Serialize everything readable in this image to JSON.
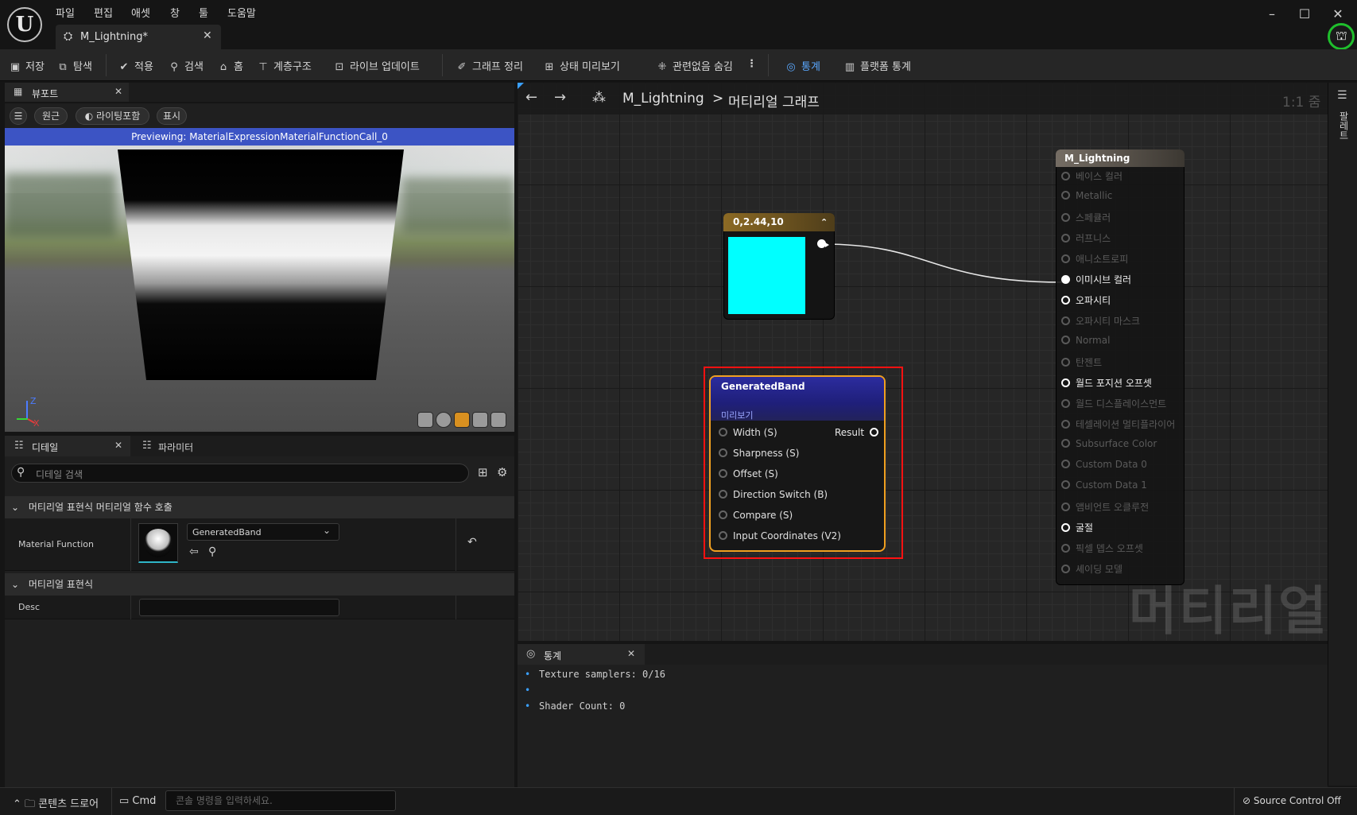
{
  "app": {
    "menu": [
      "파일",
      "편집",
      "애셋",
      "창",
      "툴",
      "도움말"
    ],
    "doc_tab": "M_Lightning*",
    "window_controls": [
      "minimize",
      "maximize",
      "close"
    ]
  },
  "toolbar": {
    "save": "저장",
    "browse": "탐색",
    "apply": "적용",
    "search": "검색",
    "home": "홈",
    "hierarchy": "계층구조",
    "live_update": "라이브 업데이트",
    "clean_graph": "그래프 정리",
    "state_preview": "상태 미리보기",
    "hide_unrelated": "관련없음 숨김",
    "stats": "통계",
    "platform_stats": "플랫폼 통계"
  },
  "viewport": {
    "tab_label": "뷰포트",
    "perspective": "원근",
    "lighting": "라이팅포함",
    "show": "표시",
    "preview_banner": "Previewing: MaterialExpressionMaterialFunctionCall_0",
    "axis_z": "Z",
    "axis_x": "X"
  },
  "details": {
    "tab_label": "디테일",
    "params_tab_label": "파라미터",
    "search_placeholder": "디테일 검색",
    "section1": "머티리얼 표현식 머티리얼 함수 호출",
    "prop_material_function": "Material Function",
    "material_function_value": "GeneratedBand",
    "section2": "머티리얼 표현식",
    "prop_desc": "Desc",
    "desc_value": ""
  },
  "graph": {
    "breadcrumb_root": "M_Lightning",
    "breadcrumb_sep": ">",
    "breadcrumb_leaf": "머티리얼 그래프",
    "zoom": "1:1 줌",
    "watermark": "머티리얼",
    "right_strip_label": "팔레트"
  },
  "constant_node": {
    "title": "0,2.44,10",
    "color": "#00ffff"
  },
  "material_node": {
    "title": "M_Lightning",
    "pins": [
      {
        "label": "베이스 컬러",
        "active": false,
        "connected": false
      },
      {
        "label": "Metallic",
        "active": false,
        "connected": false
      },
      {
        "label": "스페큘러",
        "active": false,
        "connected": false
      },
      {
        "label": "러프니스",
        "active": false,
        "connected": false
      },
      {
        "label": "애니소트로피",
        "active": false,
        "connected": false
      },
      {
        "label": "이미시브 컬러",
        "active": true,
        "connected": true
      },
      {
        "label": "오파시티",
        "active": true,
        "connected": false
      },
      {
        "label": "오파시티 마스크",
        "active": false,
        "connected": false
      },
      {
        "label": "Normal",
        "active": false,
        "connected": false
      },
      {
        "label": "탄젠트",
        "active": false,
        "connected": false
      },
      {
        "label": "월드 포지션 오프셋",
        "active": true,
        "connected": false
      },
      {
        "label": "월드 디스플레이스먼트",
        "active": false,
        "connected": false
      },
      {
        "label": "테셀레이션 멀티플라이어",
        "active": false,
        "connected": false
      },
      {
        "label": "Subsurface Color",
        "active": false,
        "connected": false
      },
      {
        "label": "Custom Data 0",
        "active": false,
        "connected": false
      },
      {
        "label": "Custom Data 1",
        "active": false,
        "connected": false
      },
      {
        "label": "앰비언트 오클루전",
        "active": false,
        "connected": false
      },
      {
        "label": "굴절",
        "active": true,
        "connected": false
      },
      {
        "label": "픽셀 뎁스 오프셋",
        "active": false,
        "connected": false
      },
      {
        "label": "셰이딩 모델",
        "active": false,
        "connected": false
      }
    ]
  },
  "band_node": {
    "title": "GeneratedBand",
    "subtitle": "미리보기",
    "output": "Result",
    "inputs": [
      "Width (S)",
      "Sharpness (S)",
      "Offset (S)",
      "Direction Switch (B)",
      "Compare (S)",
      "Input Coordinates (V2)"
    ]
  },
  "stats": {
    "tab_label": "통계",
    "lines": [
      "Texture samplers: 0/16",
      "",
      "Shader Count: 0"
    ]
  },
  "bottom": {
    "content_drawer": "콘텐츠 드로어",
    "cmd": "Cmd",
    "cmd_placeholder": "콘솔 명령을 입력하세요.",
    "source_control": "Source Control Off"
  },
  "colors": {
    "accent_blue": "#3c54c4",
    "selection_red": "#ff1111",
    "node_orange": "#f0a020",
    "profile_green": "#1fbf2c"
  }
}
